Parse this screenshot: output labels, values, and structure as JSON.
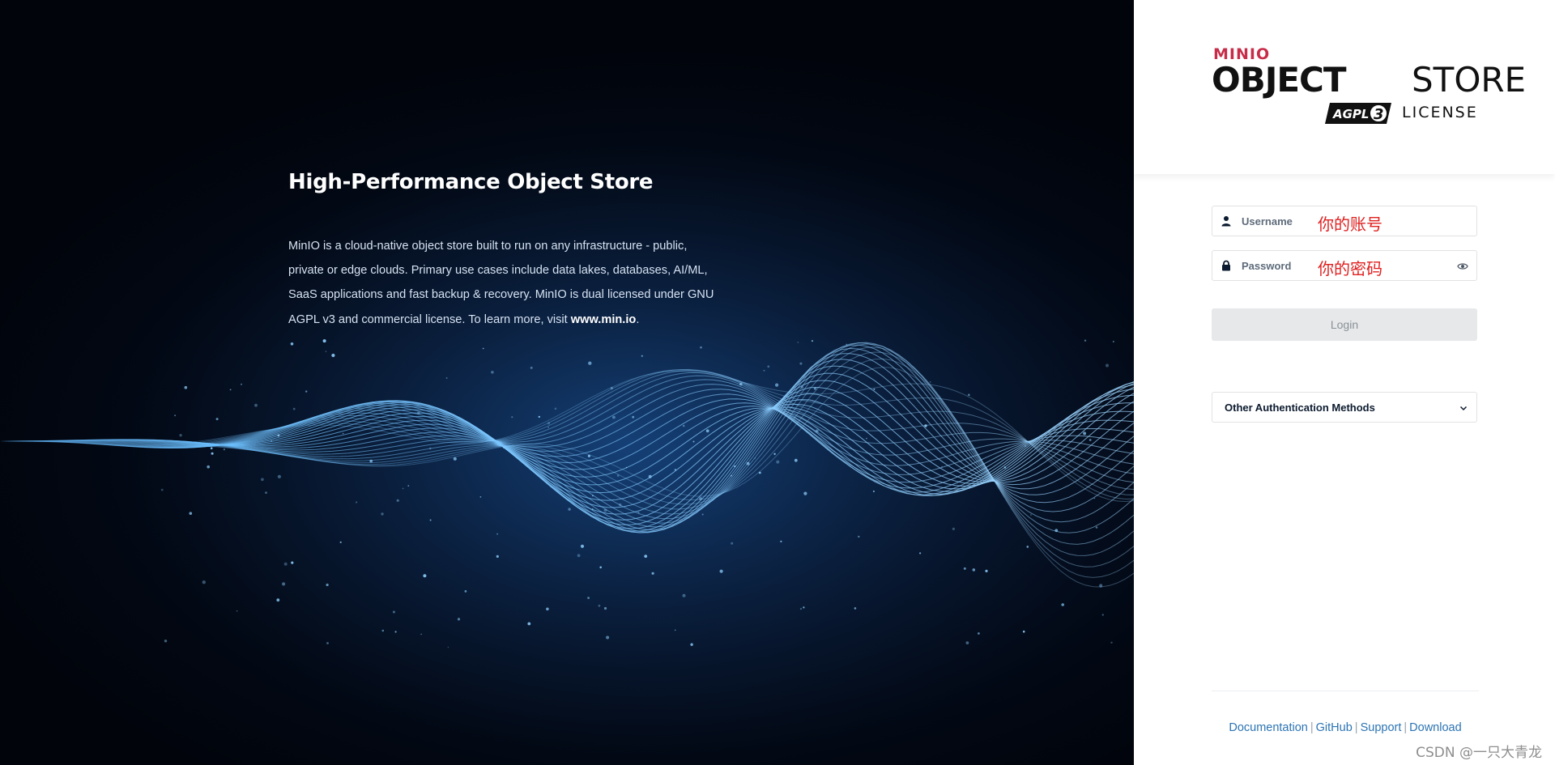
{
  "hero": {
    "title": "High-Performance Object Store",
    "body_text": "MinIO is a cloud-native object store built to run on any infrastructure - public, private or edge clouds. Primary use cases include data lakes, databases, AI/ML, SaaS applications and fast backup & recovery. MinIO is dual licensed under GNU AGPL v3 and commercial license. To learn more, visit ",
    "link_text": "www.min.io",
    "link_suffix": "."
  },
  "logo": {
    "brand": "MINIO",
    "product_bold": "OBJECT",
    "product_light": "STORE",
    "agpl_badge": "AGPLv3",
    "license": "LICENSE"
  },
  "form": {
    "username_label": "Username",
    "username_value": "你的账号",
    "password_label": "Password",
    "password_value": "你的密码",
    "login_label": "Login",
    "other_auth_label": "Other Authentication Methods"
  },
  "footer": {
    "links": [
      "Documentation",
      "GitHub",
      "Support",
      "Download"
    ],
    "separator": "|"
  },
  "watermark": "CSDN @一只大青龙",
  "icons": {
    "username": "user-icon",
    "password": "lock-icon",
    "reveal": "eye-icon",
    "dropdown": "chevron-down-icon"
  },
  "colors": {
    "brand_red": "#c72c48",
    "link_blue": "#2c74b3",
    "annotation_red": "#e02020",
    "hero_bg": "#020814"
  }
}
